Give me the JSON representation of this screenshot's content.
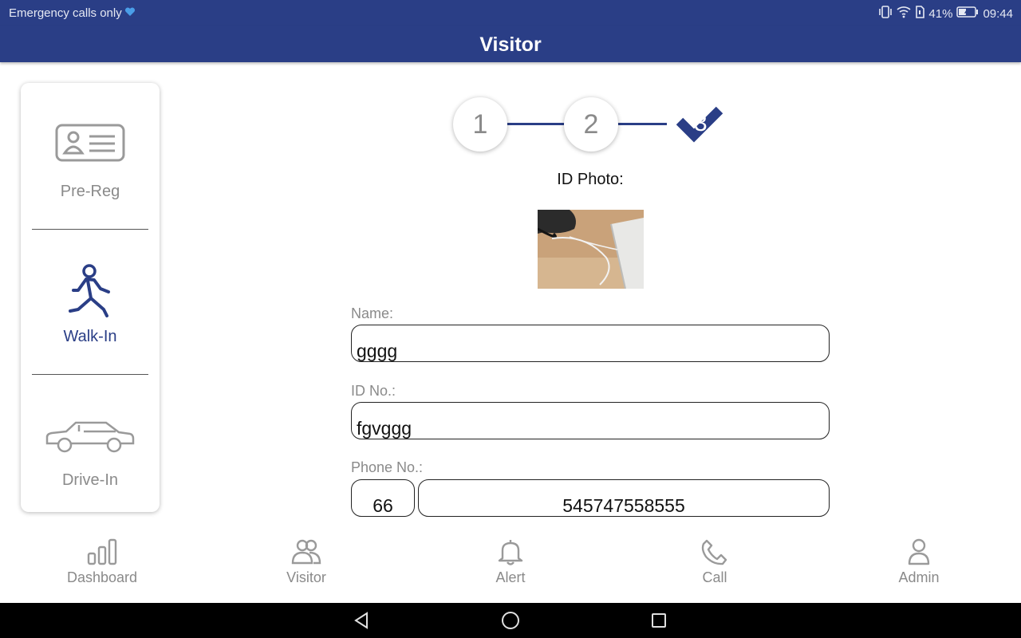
{
  "status_bar": {
    "carrier_text": "Emergency calls only",
    "battery": "41%",
    "time": "09:44"
  },
  "header": {
    "title": "Visitor"
  },
  "modes": [
    {
      "label": "Pre-Reg",
      "icon": "id-card-icon",
      "active": false
    },
    {
      "label": "Walk-In",
      "icon": "walking-person-icon",
      "active": true
    },
    {
      "label": "Drive-In",
      "icon": "car-icon",
      "active": false
    }
  ],
  "stepper": {
    "steps": [
      "1",
      "2",
      "3"
    ],
    "completed_icon": "check-icon"
  },
  "form": {
    "id_photo_label": "ID Photo:",
    "name_label": "Name:",
    "name_value": "gggg",
    "id_label": "ID No.:",
    "id_value": "fgvggg",
    "phone_label": "Phone No.:",
    "phone_code": "66",
    "phone_number": "545747558555"
  },
  "tabs": [
    {
      "label": "Dashboard",
      "icon": "bar-chart-icon"
    },
    {
      "label": "Visitor",
      "icon": "people-icon"
    },
    {
      "label": "Alert",
      "icon": "bell-icon"
    },
    {
      "label": "Call",
      "icon": "phone-icon"
    },
    {
      "label": "Admin",
      "icon": "user-icon"
    }
  ],
  "colors": {
    "primary": "#2a3e86",
    "muted": "#8a8a8a",
    "navbar": "#000000"
  }
}
